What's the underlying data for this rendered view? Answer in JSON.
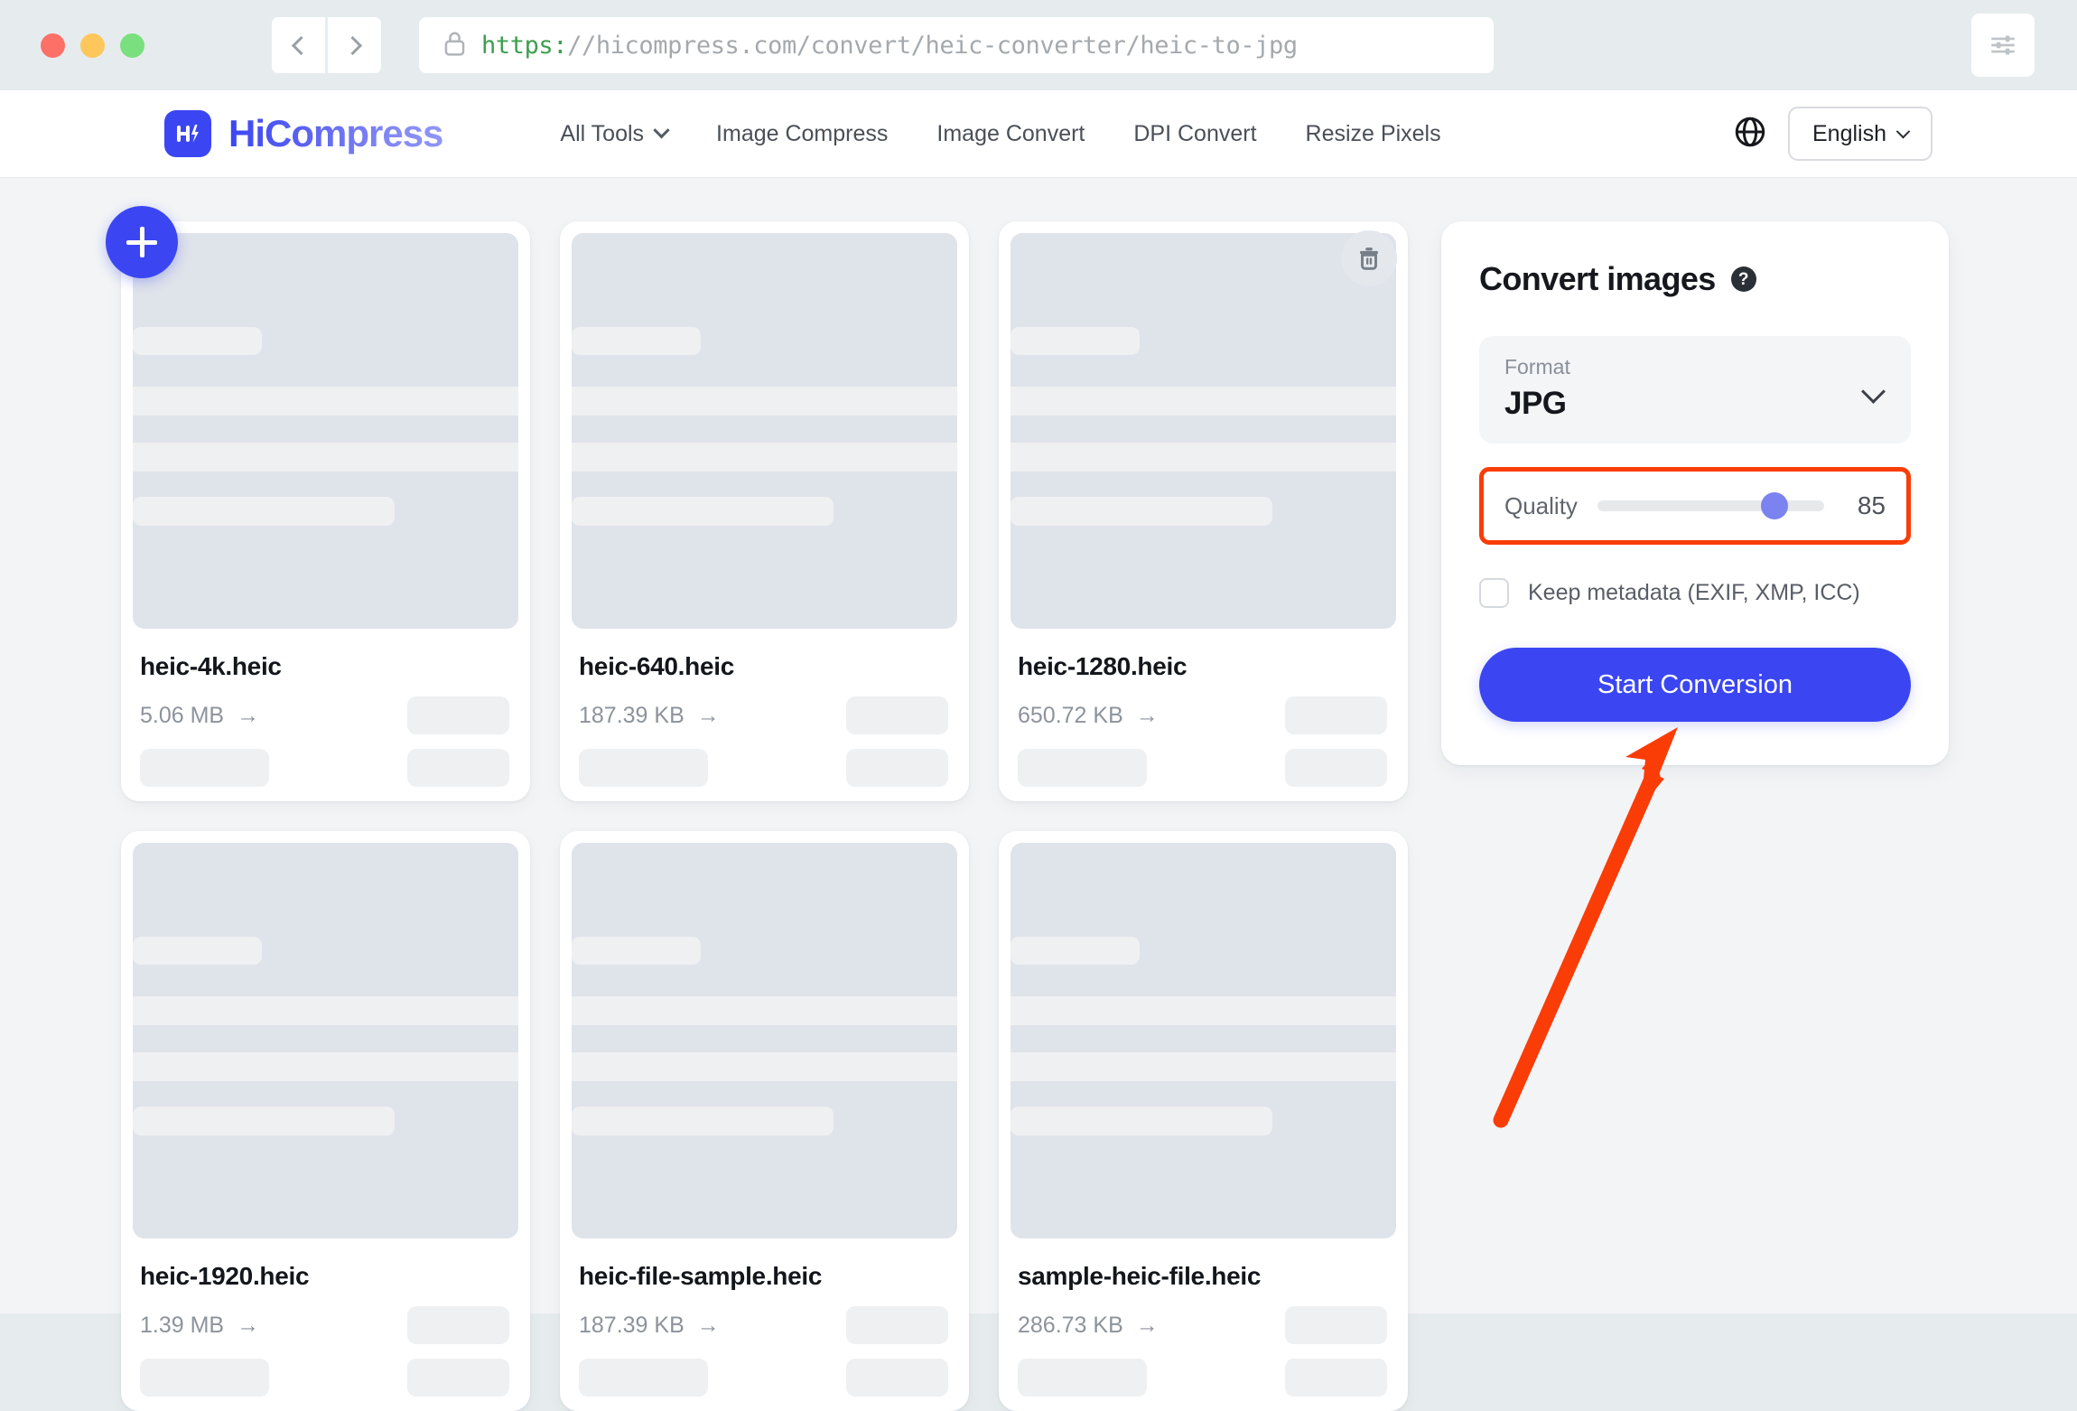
{
  "browser": {
    "url_scheme": "https:",
    "url_rest": "//hicompress.com/convert/heic-converter/heic-to-jpg",
    "back_label": "Back",
    "forward_label": "Forward",
    "lock_icon": "lock-icon",
    "settings_icon": "sliders-icon",
    "traffic_lights": [
      "close",
      "minimize",
      "zoom"
    ]
  },
  "header": {
    "brand": "HiCompress",
    "brand_mark_icon": "hicompress-logo-icon",
    "nav": [
      {
        "label": "All Tools",
        "has_chevron": true
      },
      {
        "label": "Image Compress",
        "has_chevron": false
      },
      {
        "label": "Image Convert",
        "has_chevron": false
      },
      {
        "label": "DPI Convert",
        "has_chevron": false
      },
      {
        "label": "Resize Pixels",
        "has_chevron": false
      }
    ],
    "globe_icon": "globe-icon",
    "language": "English"
  },
  "files": {
    "add_button_icon": "plus-icon",
    "delete_button_icon": "trash-icon",
    "arrow_glyph": "→",
    "items": [
      {
        "name": "heic-4k.heic",
        "size": "5.06 MB",
        "has_add": true,
        "has_delete": false
      },
      {
        "name": "heic-640.heic",
        "size": "187.39 KB",
        "has_add": false,
        "has_delete": false
      },
      {
        "name": "heic-1280.heic",
        "size": "650.72 KB",
        "has_add": false,
        "has_delete": true
      },
      {
        "name": "heic-1920.heic",
        "size": "1.39 MB",
        "has_add": false,
        "has_delete": false
      },
      {
        "name": "heic-file-sample.heic",
        "size": "187.39 KB",
        "has_add": false,
        "has_delete": false
      },
      {
        "name": "sample-heic-file.heic",
        "size": "286.73 KB",
        "has_add": false,
        "has_delete": false
      }
    ]
  },
  "panel": {
    "title": "Convert images",
    "help_icon": "help-circle-icon",
    "help_glyph": "?",
    "format_label": "Format",
    "format_value": "JPG",
    "format_chevron_icon": "chevron-down-icon",
    "quality_label": "Quality",
    "quality_value": "85",
    "quality_percent": 78,
    "keep_metadata_label": "Keep metadata (EXIF, XMP, ICC)",
    "keep_metadata_checked": false,
    "start_button": "Start Conversion"
  },
  "annotation": {
    "highlight_color": "#f93d08",
    "arrow_color": "#fa3c07",
    "arrow_target": "start-conversion-button"
  },
  "colors": {
    "brand_blue": "#3b46f2",
    "slider_thumb": "#7b83f0",
    "page_bg": "#f2f4f6",
    "thumb_bg": "#dfe3ea",
    "skeleton": "#eff0f1"
  }
}
